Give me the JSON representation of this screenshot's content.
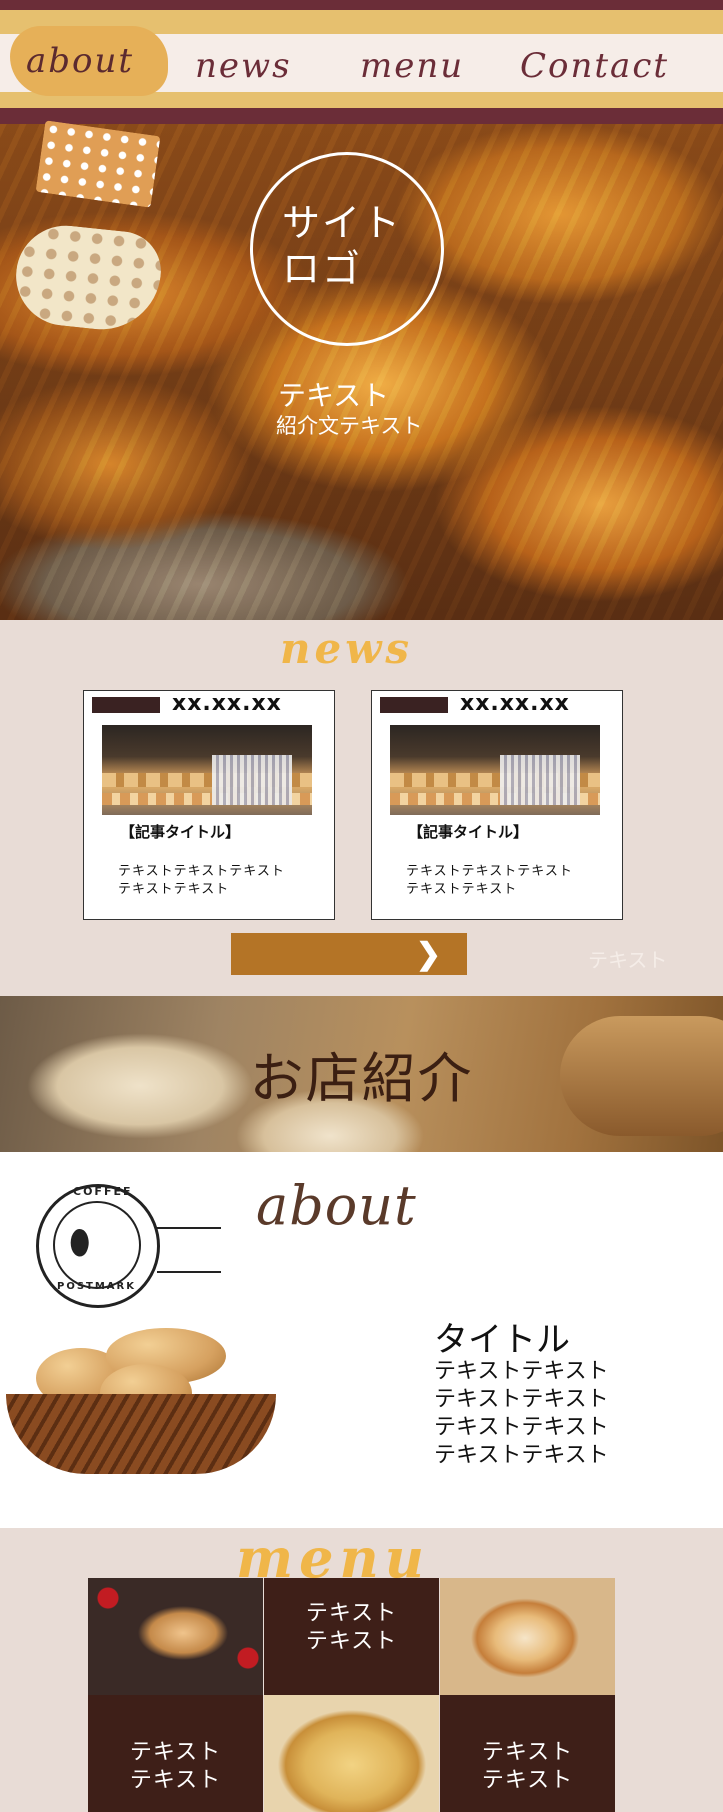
{
  "nav": {
    "items": [
      {
        "label": "about"
      },
      {
        "label": "news"
      },
      {
        "label": "menu"
      },
      {
        "label": "Contact"
      }
    ]
  },
  "hero": {
    "logo": "サイト\nロゴ",
    "title": "テキスト",
    "subtitle": "紹介文テキスト"
  },
  "news": {
    "heading": "news",
    "cards": [
      {
        "date": "xx.xx.xx",
        "title": "【記事タイトル】",
        "body": "テキストテキストテキスト\nテキストテキスト"
      },
      {
        "date": "xx.xx.xx",
        "title": "【記事タイトル】",
        "body": "テキストテキストテキスト\nテキストテキスト"
      }
    ],
    "more_icon": "chevron-right-icon",
    "aside_text": "テキスト"
  },
  "shop": {
    "title": "お店紹介"
  },
  "about": {
    "heading": "about",
    "postmark_top": "COFFEE",
    "postmark_bottom": "POSTMARK",
    "title": "タイトル",
    "body": "テキストテキスト\nテキストテキスト\nテキストテキスト\nテキストテキスト"
  },
  "menu": {
    "heading": "menu",
    "cells": [
      {
        "text": "テキスト\nテキスト"
      },
      {
        "text": "テキスト\nテキスト"
      },
      {
        "text": "テキスト\nテキスト"
      }
    ]
  },
  "colors": {
    "brand_dark": "#6b2d38",
    "gold": "#e6c06f",
    "accent_orange": "#f0b649",
    "button_brown": "#b47426",
    "panel_beige": "#e8dcd6",
    "menu_dark": "#3e1f18"
  }
}
